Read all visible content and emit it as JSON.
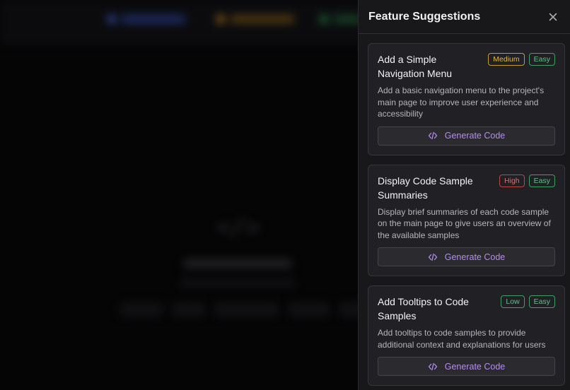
{
  "panel": {
    "title": "Feature Suggestions",
    "generate_label": "Generate Code",
    "cards": [
      {
        "title": "Add a Simple Navigation Menu",
        "priority": "Medium",
        "difficulty": "Easy",
        "description": "Add a basic navigation menu to the project's main page to improve user experience and accessibility"
      },
      {
        "title": "Display Code Sample Summaries",
        "priority": "High",
        "difficulty": "Easy",
        "description": "Display brief summaries of each code sample on the main page to give users an overview of the available samples"
      },
      {
        "title": "Add Tooltips to Code Samples",
        "priority": "Low",
        "difficulty": "Easy",
        "description": "Add tooltips to code samples to provide additional context and explanations for users"
      }
    ]
  },
  "icons": {
    "close": "close-icon",
    "generate": "code-icon"
  },
  "colors": {
    "panel_bg": "#18181b",
    "card_bg": "#212125",
    "accent_purple": "#b68cf0",
    "badge_medium": "#e0b84a",
    "badge_high": "#e46a6a",
    "badge_low": "#5cc488",
    "badge_easy": "#5cc488"
  }
}
